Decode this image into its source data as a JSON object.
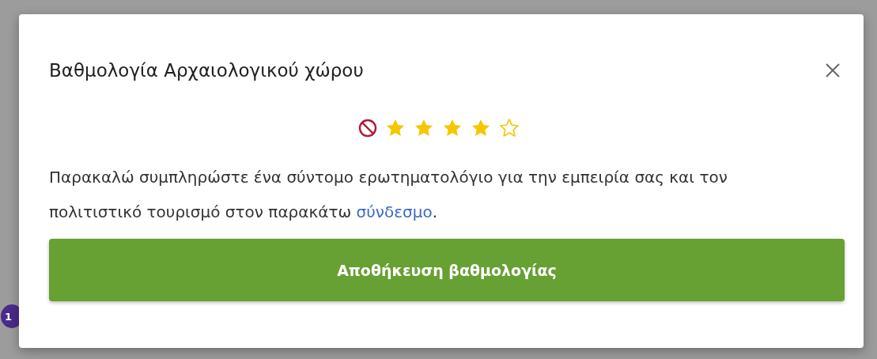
{
  "background": {
    "badge": "1"
  },
  "dialog": {
    "title": "Βαθμολογία Αρχαιολογικού χώρου",
    "rating": {
      "stars": 4
    },
    "message": "Παρακαλώ συμπληρώστε ένα σύντομο ερωτηματολόγιο για την εμπειρία σας και τον πολιτιστικό τουρισμό στον παρακάτω",
    "link": "σύνδεσμο",
    "message_end": ".",
    "button": "Αποθήκευση βαθμολογίας"
  }
}
